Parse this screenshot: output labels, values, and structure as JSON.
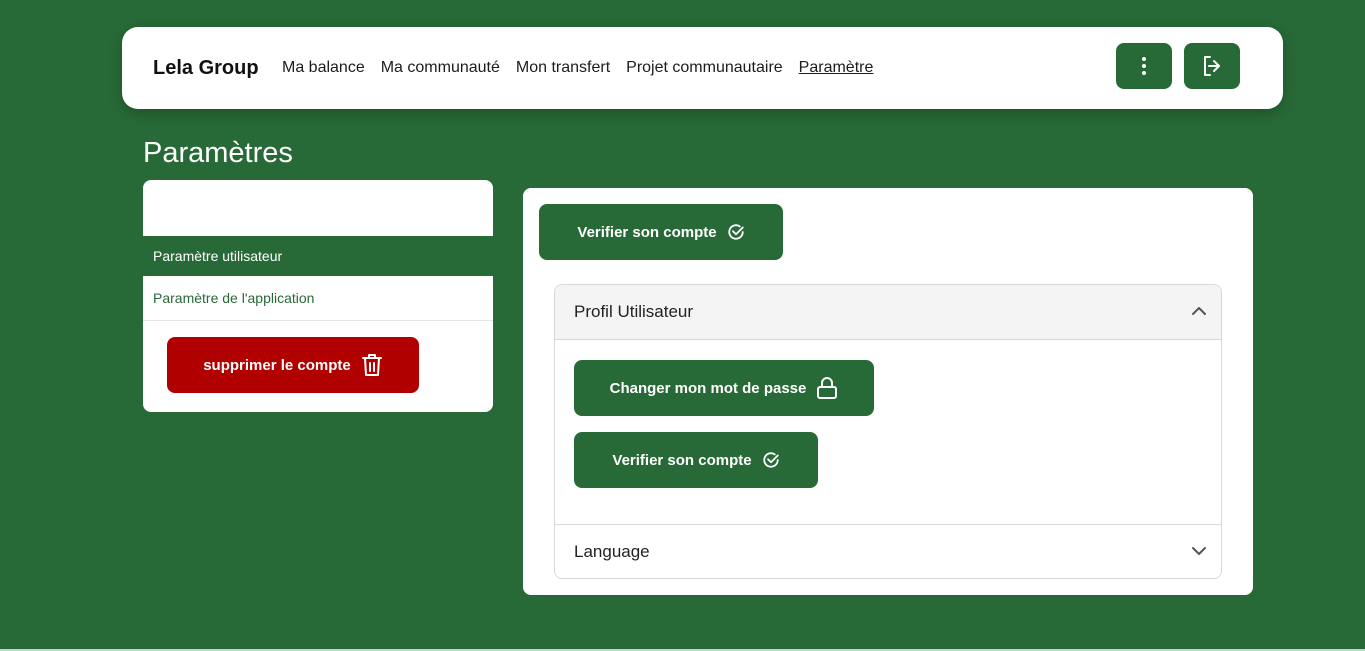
{
  "brand": "Lela Group",
  "nav": {
    "links": [
      "Ma balance",
      "Ma communauté",
      "Mon transfert",
      "Projet communautaire",
      "Paramètre"
    ],
    "active_index": 4,
    "icons": [
      "more-vertical-icon",
      "logout-icon"
    ]
  },
  "page_title": "Paramètres",
  "sidebar": {
    "items": [
      {
        "label": "Paramètre utilisateur",
        "active": true
      },
      {
        "label": "Paramètre de l'application",
        "active": false
      }
    ],
    "delete_label": "supprimer le compte",
    "delete_icon": "trash-icon"
  },
  "main": {
    "verify_top_label": "Verifier son compte",
    "verify_icon": "check-circle-icon",
    "accordion": [
      {
        "title": "Profil Utilisateur",
        "expanded": true,
        "buttons": [
          {
            "label": "Changer mon mot de passe",
            "icon": "lock-icon"
          },
          {
            "label": "Verifier son compte",
            "icon": "check-circle-icon"
          }
        ]
      },
      {
        "title": "Language",
        "expanded": false
      }
    ]
  },
  "colors": {
    "primary": "#286a37",
    "danger": "#b10000",
    "background": "#286a37",
    "surface": "#ffffff"
  }
}
